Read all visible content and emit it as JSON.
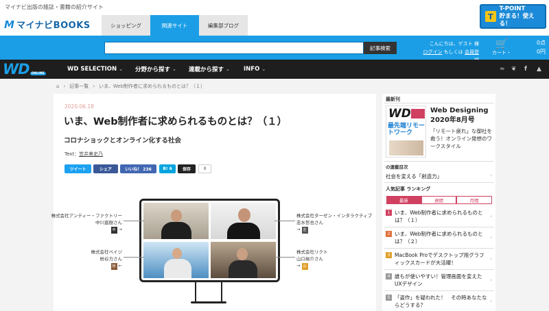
{
  "header": {
    "tagline": "マイナビ出版の雑誌・書籍の紹介サイト",
    "logo_mark": "M",
    "logo_text": "マイナビBOOKS",
    "tabs": [
      {
        "label": "ショッピング",
        "active": false
      },
      {
        "label": "関連サイト",
        "active": true
      },
      {
        "label": "編集部ブログ",
        "active": false
      }
    ],
    "tpoint_line1": "T-POINT",
    "tpoint_line2": "貯まる！使える！"
  },
  "searchbar": {
    "placeholder": "",
    "button_label": "記事検索",
    "greeting": "こんにちは、ゲスト 様",
    "login_link": "ログイン",
    "or_text": "もしくは",
    "register_link": "会員登録",
    "cart_label": "カート・",
    "cart_items": "0点",
    "cart_price": "0円"
  },
  "nav": {
    "logo": "WD",
    "logo_badge": "ONLINE",
    "items": [
      {
        "label": "WD SELECTION"
      },
      {
        "label": "分野から探す"
      },
      {
        "label": "連載から探す"
      },
      {
        "label": "INFO"
      }
    ],
    "social": [
      "rss",
      "twitter",
      "facebook",
      "feedly"
    ]
  },
  "breadcrumb": {
    "home_icon": "home-icon",
    "items": [
      "記事一覧",
      "いま、Web制作者に求められるものとは？（１）"
    ]
  },
  "article": {
    "date": "2020.06.18",
    "title": "いま、Web制作者に求められるものとは？（１）",
    "subtitle": "コロナショックとオンライン化する社会",
    "text_prefix": "Text：",
    "author": "笠井美史乃",
    "share": [
      {
        "label": "ツイート",
        "color": "#1da1f2"
      },
      {
        "label": "シェア",
        "color": "#3b5998"
      },
      {
        "label": "いいね！ 236",
        "color": "#4267b2"
      },
      {
        "label": "B! 6",
        "color": "#00a4de"
      },
      {
        "label": "保存",
        "color": "#222222"
      }
    ],
    "share_count": "0",
    "figure": {
      "left_top": {
        "company": "株式会社アンティー・ファクトリー",
        "name": "中川直樹さん",
        "tag": "中"
      },
      "left_bottom": {
        "company": "株式会社ベイジ",
        "name": "枌谷力さん",
        "tag": "枌"
      },
      "right_top": {
        "company": "株式会社ターゼン・インタラクティブ",
        "name": "志水哲也さん",
        "tag": "志"
      },
      "right_bottom": {
        "company": "株式会社リクト",
        "name": "山口裕介さん",
        "tag": "山"
      }
    }
  },
  "sidebar": {
    "latest_heading": "最新刊",
    "mag_cover_brand": "WD",
    "mag_cover_headline": "最先端リモートワーク",
    "mag_title_line1": "Web Designing",
    "mag_title_line2": "2020年8月号",
    "mag_desc": "「リモート疲れ」な御社を救う！オンライン発想のワークスタイル",
    "series_heading": "の連載目次",
    "series_item": "社会を変える「創造力」",
    "ranking_heading": "人気記事 ランキング",
    "ranking_tabs": [
      {
        "label": "最新",
        "active": true
      },
      {
        "label": "週間",
        "active": false
      },
      {
        "label": "月間",
        "active": false
      }
    ],
    "ranking": [
      {
        "num": "1",
        "text": "いま、Web制作者に求められるものとは？（１）",
        "color": "#d04060"
      },
      {
        "num": "2",
        "text": "いま、Web制作者に求められるものとは？（２）",
        "color": "#e0703a"
      },
      {
        "num": "3",
        "text": "MacBook Proでデスクトップ用グラフィックスカードが大活躍！",
        "color": "#e0a02a"
      },
      {
        "num": "4",
        "text": "誰もが使いやすい！管理画面を変えたUXデザイン",
        "color": "#999999"
      },
      {
        "num": "5",
        "text": "「盗作」を疑われた！　その時あなたならどうする？",
        "color": "#999999"
      }
    ]
  }
}
